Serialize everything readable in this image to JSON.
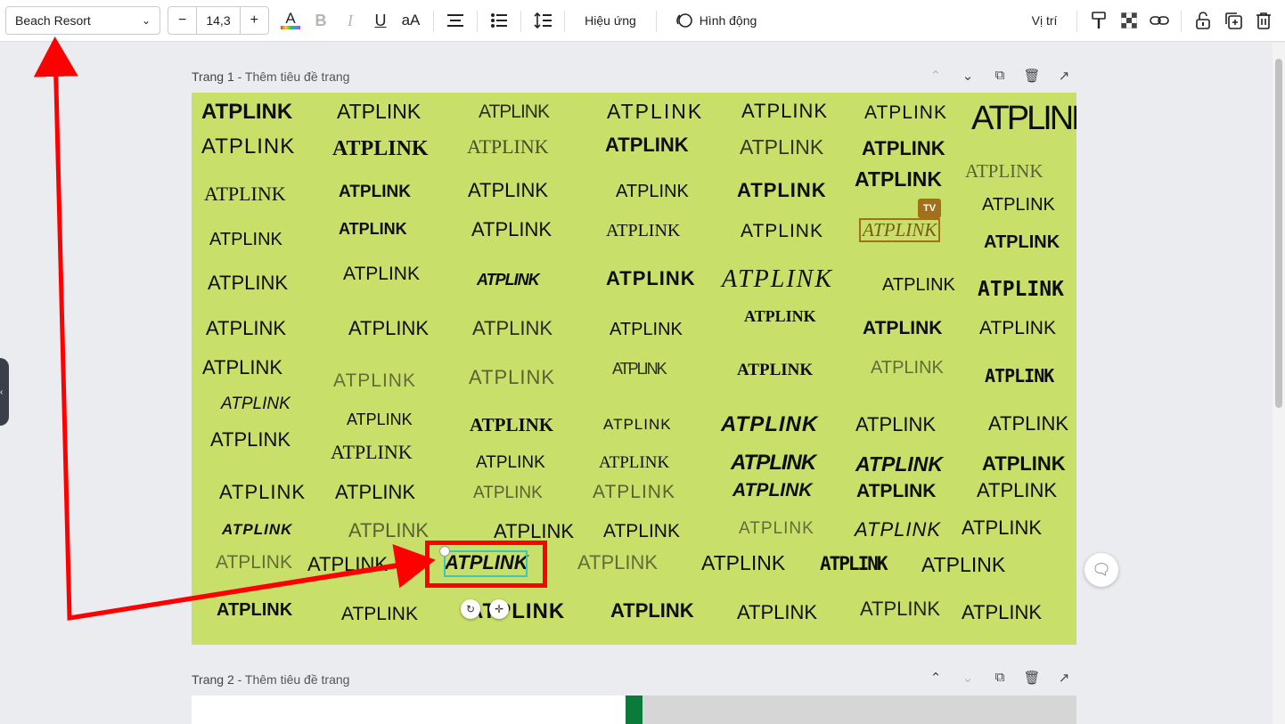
{
  "toolbar": {
    "font_name": "Beach Resort",
    "font_size": "14,3",
    "minus": "−",
    "plus": "+",
    "effects_label": "Hiệu ứng",
    "animate_label": "Hình động",
    "position_label": "Vị trí",
    "icons": [
      "text-color-icon",
      "bold-icon",
      "italic-icon",
      "underline-icon",
      "case-icon",
      "align-icon",
      "list-icon",
      "spacing-icon",
      "paint-format-icon",
      "transparency-icon",
      "link-icon",
      "lock-icon",
      "duplicate-icon",
      "trash-icon"
    ]
  },
  "pages": [
    {
      "number": "Trang 1",
      "title_placeholder": " - Thêm tiêu đề trang"
    },
    {
      "number": "Trang 2",
      "title_placeholder": " - Thêm tiêu đề trang"
    }
  ],
  "canvas": {
    "background": "#c8e06a",
    "word": "ATPLINK",
    "badge": "TV",
    "overlap_word": "ATPLINK"
  },
  "colors": {
    "accent_red": "#ff0000",
    "selection": "#3cc7b7",
    "page2_green": "#0c7a3a"
  }
}
